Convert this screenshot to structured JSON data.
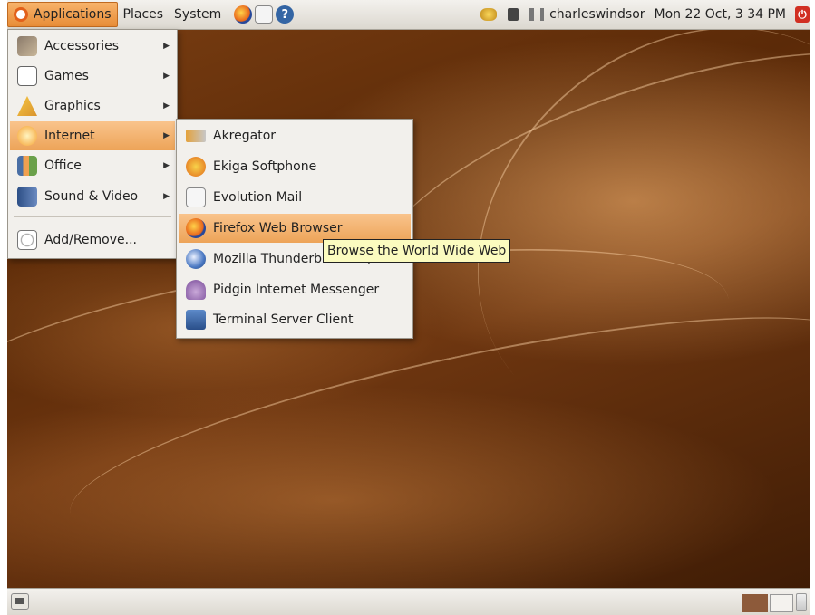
{
  "top_panel": {
    "menus": {
      "applications": "Applications",
      "places": "Places",
      "system": "System"
    },
    "launchers": [
      "firefox-icon",
      "mail-icon",
      "help-icon"
    ],
    "help_glyph": "?",
    "tray": {
      "user": "charleswindsor",
      "clock": "Mon 22 Oct,  3 34 PM"
    }
  },
  "applications_menu": {
    "items": [
      {
        "label": "Accessories",
        "icon": "accessories-icon",
        "submenu": true
      },
      {
        "label": "Games",
        "icon": "games-icon",
        "submenu": true
      },
      {
        "label": "Graphics",
        "icon": "graphics-icon",
        "submenu": true
      },
      {
        "label": "Internet",
        "icon": "internet-icon",
        "submenu": true,
        "active": true
      },
      {
        "label": "Office",
        "icon": "office-icon",
        "submenu": true
      },
      {
        "label": "Sound & Video",
        "icon": "sound-video-icon",
        "submenu": true
      },
      {
        "label": "Add/Remove...",
        "icon": "add-remove-icon",
        "submenu": false
      }
    ]
  },
  "internet_submenu": {
    "items": [
      {
        "label": "Akregator",
        "icon": "akregator-icon"
      },
      {
        "label": "Ekiga Softphone",
        "icon": "ekiga-icon"
      },
      {
        "label": "Evolution Mail",
        "icon": "evolution-icon"
      },
      {
        "label": "Firefox Web Browser",
        "icon": "firefox-icon",
        "active": true
      },
      {
        "label": "Mozilla Thunderbird Mail/News",
        "icon": "thunderbird-icon"
      },
      {
        "label": "Pidgin Internet Messenger",
        "icon": "pidgin-icon"
      },
      {
        "label": "Terminal Server Client",
        "icon": "tsclient-icon"
      }
    ]
  },
  "tooltip": {
    "text": "Browse the World Wide Web"
  },
  "colors": {
    "highlight": "#eda458",
    "panel": "#e6e3dd",
    "wallpaper": "#5b2a08",
    "tooltip_bg": "#fbfbbf"
  }
}
